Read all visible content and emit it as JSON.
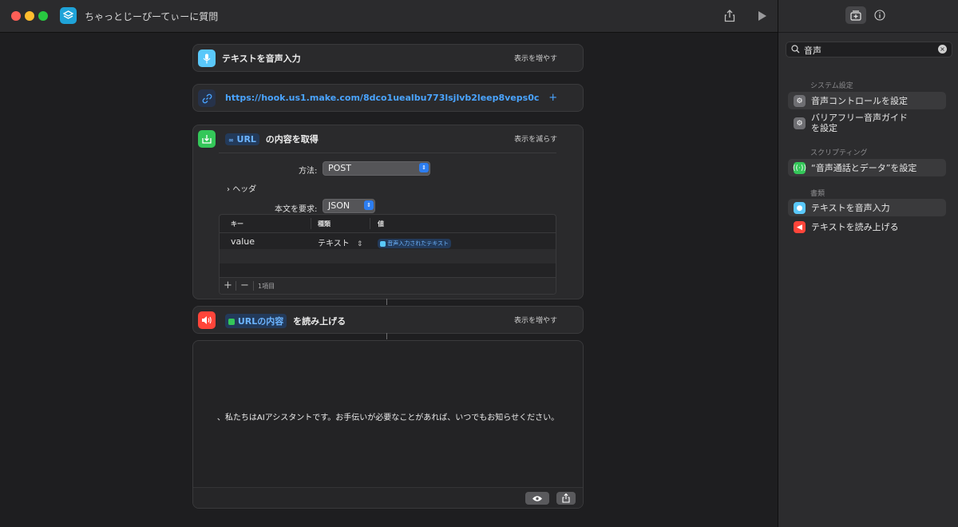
{
  "window": {
    "title": "ちゃっとじーぴーてぃーに質問"
  },
  "actions": {
    "dictate": {
      "title": "テキストを音声入力",
      "link": "表示を増やす"
    },
    "url": {
      "value": "https://hook.us1.make.com/8dco1uealbu773lsjlvb2leep8veps0c",
      "add": "+"
    },
    "get_contents": {
      "token": "URL",
      "title": "の内容を取得",
      "link": "表示を減らす",
      "method_label": "方法:",
      "method_value": "POST",
      "headers_label": "ヘッダ",
      "body_label": "本文を要求:",
      "body_value": "JSON",
      "table": {
        "headers": [
          "キー",
          "種類",
          "値"
        ],
        "rows": [
          {
            "key": "value",
            "type": "テキスト",
            "value": "音声入力されたテキスト"
          }
        ],
        "footer": {
          "add": "+",
          "remove": "−",
          "count": "1項目"
        }
      }
    },
    "speak": {
      "token": "URLの内容",
      "title": "を読み上げる",
      "link": "表示を増やす"
    }
  },
  "output": {
    "text": "、私たちはAIアシスタントです。お手伝いが必要なことがあれば、いつでもお知らせください。"
  },
  "sidebar": {
    "search_value": "音声",
    "sections": [
      {
        "title": "システム設定",
        "items": [
          "音声コントロールを設定",
          "バリアフリー音声ガイドを設定"
        ]
      },
      {
        "title": "スクリプティング",
        "items": [
          "“音声通話とデータ”を設定"
        ]
      },
      {
        "title": "書類",
        "items": [
          "テキストを音声入力",
          "テキストを読み上げる"
        ]
      }
    ]
  },
  "colors": {
    "accent": "#2c7df0",
    "link": "#4aa4ff",
    "dictate_icon": "#5ac8fa",
    "get_icon": "#34c759",
    "speak_icon": "#ff453a"
  }
}
